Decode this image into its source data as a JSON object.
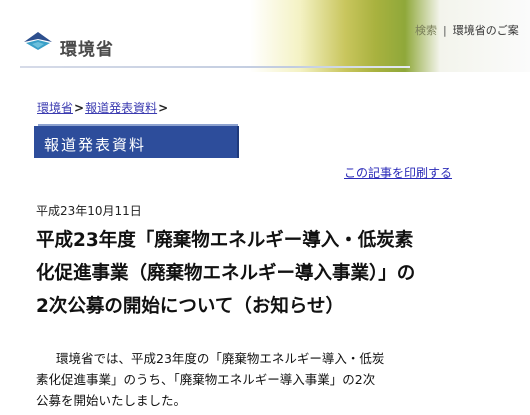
{
  "header": {
    "logo_text": "環境省",
    "right_links": {
      "partial_link": "検索",
      "separator": "|",
      "site_link": "環境省のご案"
    }
  },
  "breadcrumb": {
    "items": [
      "環境省",
      "報道発表資料"
    ],
    "separator": ">"
  },
  "section": {
    "title": "報道発表資料"
  },
  "print_link": "この記事を印刷する",
  "article": {
    "date": "平成23年10月11日",
    "title_lines": [
      "平成23年度「廃棄物エネルギー導入・低炭素",
      "化促進事業（廃棄物エネルギー導入事業）」の",
      "2次公募の開始について（お知らせ）"
    ],
    "body_lines": [
      "環境省では、平成23年度の「廃棄物エネルギー導入・低炭",
      "素化促進事業」のうち、「廃棄物エネルギー導入事業」の2次",
      "公募を開始いたしました。"
    ]
  }
}
